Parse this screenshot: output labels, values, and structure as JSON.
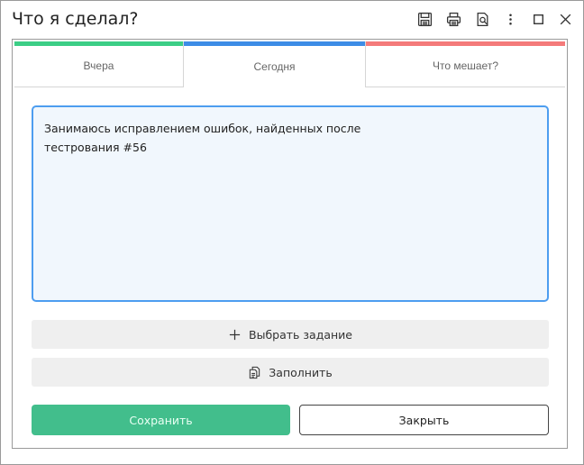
{
  "window": {
    "title": "Что я сделал?",
    "toolbar": [
      "save-icon",
      "print-icon",
      "preview-icon",
      "more-vertical-icon",
      "maximize-icon",
      "close-icon"
    ]
  },
  "tabs": [
    {
      "label": "Вчера",
      "color": "#3cce86",
      "active": false
    },
    {
      "label": "Сегодня",
      "color": "#3d8ce6",
      "active": true
    },
    {
      "label": "Что мешает?",
      "color": "#f47a7a",
      "active": false
    }
  ],
  "editor": {
    "value": "Занимаюсь исправлением ошибок, найденных после\nтестрования #56"
  },
  "actions": {
    "select_task": {
      "label": "Выбрать задание",
      "icon": "plus-icon"
    },
    "fill": {
      "label": "Заполнить",
      "icon": "copy-document-icon"
    }
  },
  "footer": {
    "save_label": "Сохранить",
    "close_label": "Закрыть"
  },
  "colors": {
    "accent": "#4d9df0",
    "save": "#42be8c"
  }
}
